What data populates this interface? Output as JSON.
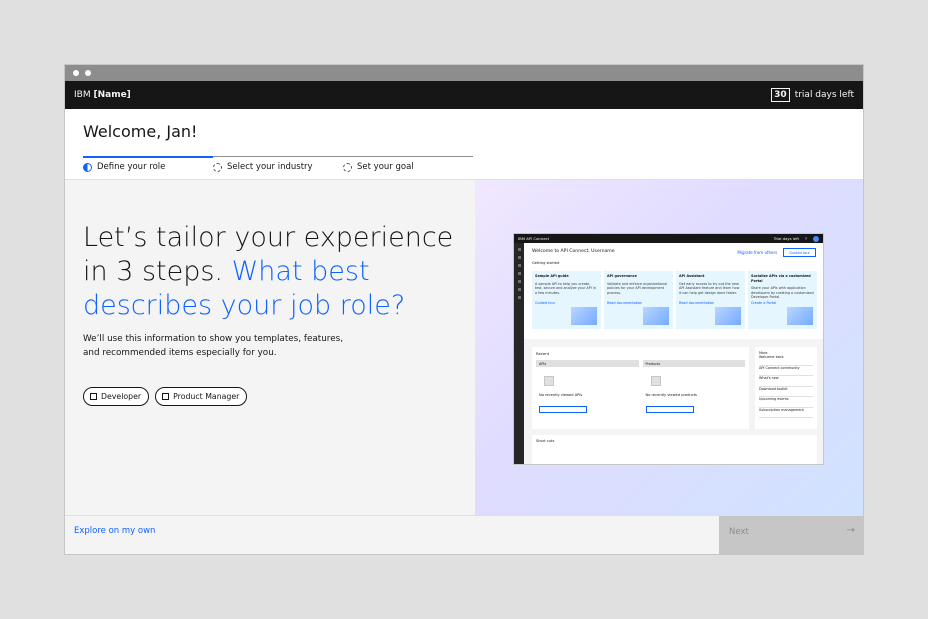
{
  "topbar": {
    "brand_prefix": "IBM",
    "brand_name": "[Name]",
    "trial_count": "30",
    "trial_label": "trial days left"
  },
  "header": {
    "welcome": "Welcome, Jan!",
    "steps": [
      {
        "label": "Define your role",
        "state": "active"
      },
      {
        "label": "Select your industry",
        "state": "pending"
      },
      {
        "label": "Set your goal",
        "state": "pending"
      }
    ]
  },
  "main": {
    "headline_plain": "Let’s tailor your experience in 3 steps.",
    "headline_accent": "What best describes your job role?",
    "subtext": "We’ll use this information to show you templates, features, and recommended items especially for you.",
    "roles": [
      "Developer",
      "Product Manager"
    ]
  },
  "preview": {
    "topbar_title": "IBM API Connect",
    "topbar_trial": "Trial days left",
    "title": "Welcome to API Connect, Username",
    "link": "Migrate from others",
    "button": "Guided tour",
    "getting_started": "Getting started",
    "cards": [
      {
        "title": "Sample API guide",
        "body": "A sample API to help you create, test, secure and analyze your API in a few minutes.",
        "link": "Guided tour"
      },
      {
        "title": "API governance",
        "body": "Validate and enforce organizational policies for your API development process.",
        "link": "Read documentation"
      },
      {
        "title": "API Assistant",
        "body": "Get early access to try out the new API Assistant feature and learn how it can help get design done faster.",
        "link": "Read documentation"
      },
      {
        "title": "Socialize APIs via a customized Portal",
        "body": "Share your APIs with application developers by creating a customized Developer Portal.",
        "link": "Create a Portal"
      }
    ],
    "recent_label": "Recent",
    "recent_cols": [
      {
        "header": "APIs",
        "text": "No recently viewed APIs",
        "button": "Start import API tour"
      },
      {
        "header": "Products",
        "text": "No recently viewed products",
        "button": "Start create product tour"
      }
    ],
    "more_label": "More",
    "more_items": [
      "Welcome back",
      "API Connect community",
      "What's new",
      "Download toolkit",
      "Upcoming events",
      "Subscription management"
    ],
    "shortcuts_label": "Short cuts"
  },
  "footer": {
    "explore": "Explore on my own",
    "next": "Next",
    "next_arrow": "→"
  },
  "colors": {
    "accent": "#0f62fe",
    "topbar": "#161616",
    "disabled": "#c6c6c6"
  }
}
